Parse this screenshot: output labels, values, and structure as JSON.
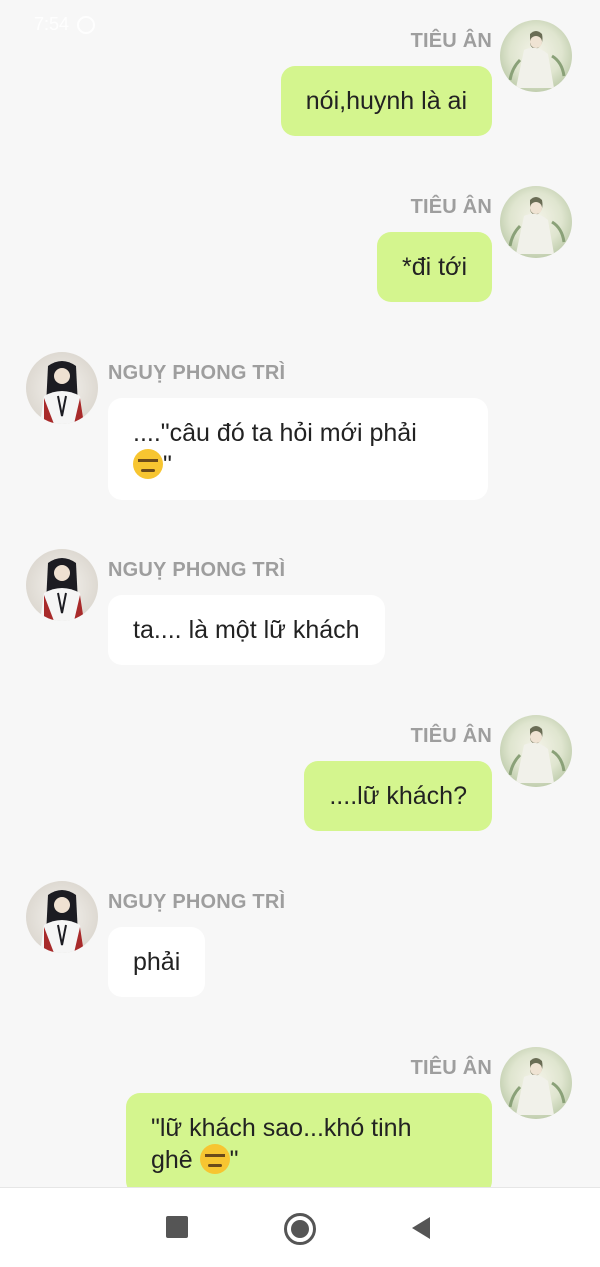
{
  "status_bar": {
    "time": "7:54"
  },
  "participants": {
    "me": {
      "name": "TIÊU ÂN"
    },
    "other": {
      "name": "NGUỴ PHONG TRÌ"
    }
  },
  "messages": [
    {
      "sender": "TIÊU ÂN",
      "text": "nói,huynh là ai"
    },
    {
      "sender": "TIÊU ÂN",
      "text": "*đi tới"
    },
    {
      "sender": "NGUỴ PHONG TRÌ",
      "text_before": "....\"câu đó ta hỏi mới phải",
      "emoji": "expressionless-face",
      "text_after": "\""
    },
    {
      "sender": "NGUỴ PHONG TRÌ",
      "text": "ta.... là một lữ khách"
    },
    {
      "sender": "TIÊU ÂN",
      "text": "....lữ khách?"
    },
    {
      "sender": "NGUỴ PHONG TRÌ",
      "text": "phải"
    },
    {
      "sender": "TIÊU ÂN",
      "text_before": "\"lữ khách sao...khó tinh",
      "text_line2": "ghê ",
      "emoji": "expressionless-face",
      "text_after": "\""
    }
  ],
  "nav_bar": {
    "icons": [
      "recents-square-icon",
      "home-circle-icon",
      "back-triangle-icon"
    ]
  },
  "colors": {
    "background": "#f7f7f7",
    "outgoing_bubble": "#d4f58e",
    "incoming_bubble": "#ffffff",
    "sender_label": "#9e9e9e"
  }
}
